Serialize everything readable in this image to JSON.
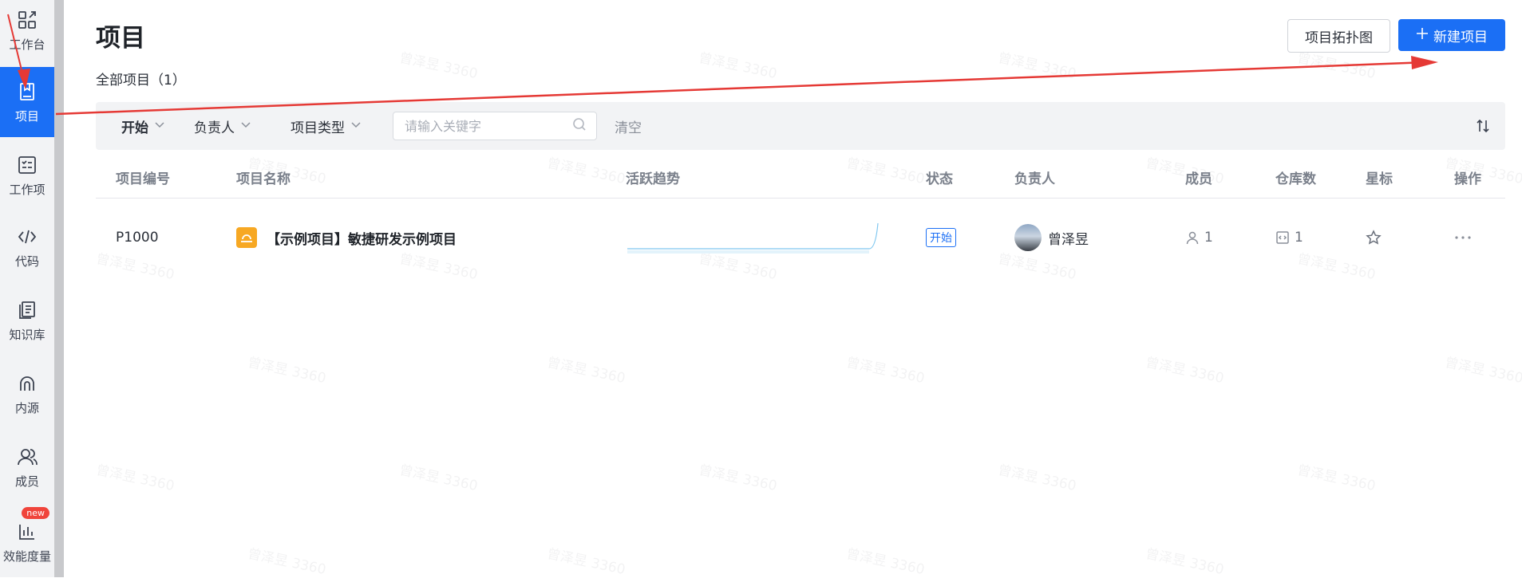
{
  "sidebar": {
    "items": [
      {
        "label": "工作台",
        "icon": "workbench-icon"
      },
      {
        "label": "项目",
        "icon": "project-icon",
        "active": true
      },
      {
        "label": "工作项",
        "icon": "task-list-icon"
      },
      {
        "label": "代码",
        "icon": "code-icon"
      },
      {
        "label": "知识库",
        "icon": "knowledge-icon"
      },
      {
        "label": "内源",
        "icon": "inner-source-icon"
      },
      {
        "label": "成员",
        "icon": "members-icon"
      },
      {
        "label": "效能度量",
        "icon": "metrics-icon",
        "badge": "new"
      }
    ]
  },
  "header": {
    "title": "项目",
    "subtitle": "全部项目（1）",
    "topology_button": "项目拓扑图",
    "new_button": "新建项目"
  },
  "filters": {
    "status": "开始",
    "owner": "负责人",
    "type": "项目类型",
    "search_placeholder": "请输入关键字",
    "clear": "清空"
  },
  "table": {
    "columns": [
      "项目编号",
      "项目名称",
      "活跃趋势",
      "状态",
      "负责人",
      "成员",
      "仓库数",
      "星标",
      "操作"
    ],
    "rows": [
      {
        "id": "P1000",
        "name": "【示例项目】敏捷研发示例项目",
        "status": "开始",
        "owner": "曾泽昱",
        "members": "1",
        "repos": "1"
      }
    ]
  },
  "watermark": "曾泽昱 3360",
  "colors": {
    "primary": "#1b6ff5",
    "annotation": "#e53935",
    "project_icon": "#f7a823"
  }
}
